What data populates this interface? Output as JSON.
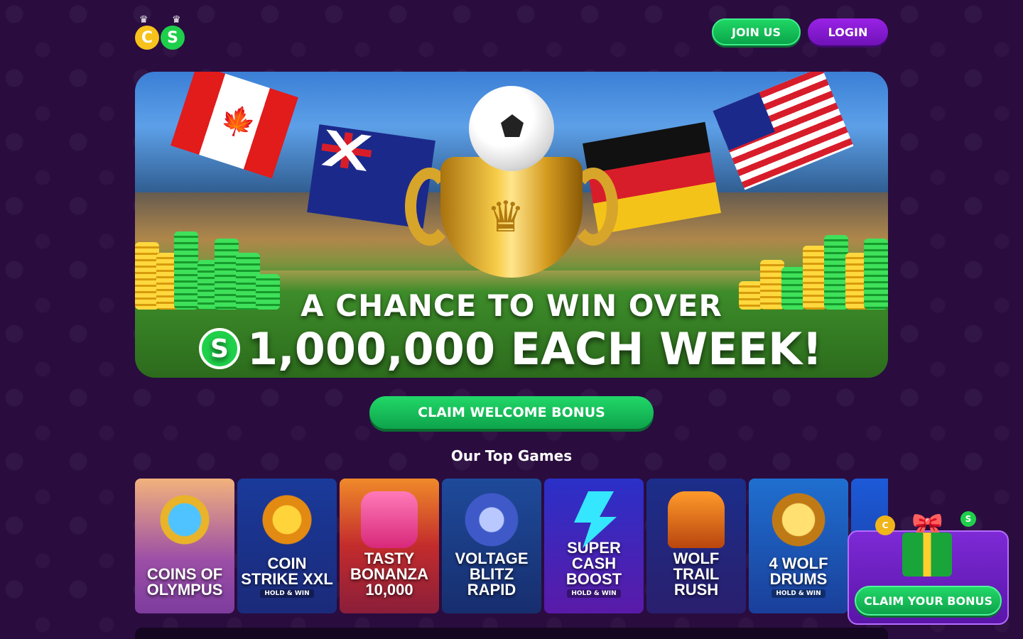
{
  "header": {
    "logo_letters": [
      "C",
      "S"
    ],
    "join_label": "JOIN US",
    "login_label": "LOGIN"
  },
  "hero": {
    "line1": "A CHANCE TO WIN OVER",
    "line2": "1,000,000 EACH WEEK!",
    "coin_symbol": "S"
  },
  "claim_welcome_label": "CLAIM WELCOME BONUS",
  "top_games": {
    "title": "Our Top Games",
    "items": [
      {
        "title": "COINS OF OLYMPUS",
        "badge": ""
      },
      {
        "title": "COIN STRIKE XXL",
        "badge": "HOLD & WIN"
      },
      {
        "title": "TASTY BONANZA 10,000",
        "badge": ""
      },
      {
        "title": "VOLTAGE BLITZ RAPID",
        "badge": ""
      },
      {
        "title": "SUPER CASH BOOST",
        "badge": "HOLD & WIN"
      },
      {
        "title": "WOLF TRAIL RUSH",
        "badge": ""
      },
      {
        "title": "4 WOLF DRUMS",
        "badge": "HOLD & WIN"
      },
      {
        "title": "",
        "badge": ""
      }
    ]
  },
  "bonus_popup": {
    "claim_label": "CLAIM YOUR BONUS"
  },
  "colors": {
    "background": "#2a0c3f",
    "green_button": "#0ea34b",
    "purple_button": "#6f12b8"
  }
}
